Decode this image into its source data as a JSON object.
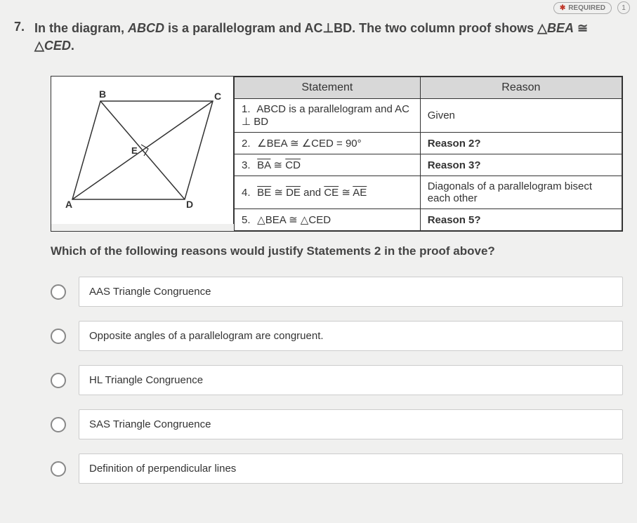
{
  "header": {
    "required_label": "REQUIRED",
    "points": "1"
  },
  "question": {
    "number": "7.",
    "text_html": "In the diagram, <span class='ital'>ABCD</span> is a parallelogram and AC⊥BD. The two column proof shows △<span class='ital'>BEA</span> ≅ △<span class='ital'>CED</span>."
  },
  "diagram": {
    "labels": {
      "A": "A",
      "B": "B",
      "C": "C",
      "D": "D",
      "E": "E"
    }
  },
  "proof_table": {
    "headers": {
      "statement": "Statement",
      "reason": "Reason"
    },
    "rows": [
      {
        "n": "1.",
        "statement_html": "<span class='ital'>ABCD</span> is a parallelogram and <span class='ital'>AC</span> ⊥ <span class='ital'>BD</span>",
        "reason": "Given"
      },
      {
        "n": "2.",
        "statement_html": "∠<span class='ital'>BEA</span> ≅ ∠<span class='ital'>CED</span> = 90°",
        "reason": "Reason 2?"
      },
      {
        "n": "3.",
        "statement_html": "<span class='overline ital'>BA</span> ≅ <span class='overline ital'>CD</span>",
        "reason": "Reason 3?"
      },
      {
        "n": "4.",
        "statement_html": "<span class='overline ital'>BE</span> ≅ <span class='overline ital'>DE</span> and <span class='overline ital'>CE</span> ≅ <span class='overline ital'>AE</span>",
        "reason": "Diagonals of a parallelogram bisect each other"
      },
      {
        "n": "5.",
        "statement_html": "△<span class='ital'>BEA</span> ≅ △<span class='ital'>CED</span>",
        "reason": "Reason 5?"
      }
    ]
  },
  "follow_question": "Which of the following reasons would justify Statements 2 in the proof above?",
  "options": [
    "AAS Triangle Congruence",
    "Opposite angles of a parallelogram are congruent.",
    "HL Triangle Congruence",
    "SAS Triangle Congruence",
    "Definition of perpendicular lines"
  ]
}
